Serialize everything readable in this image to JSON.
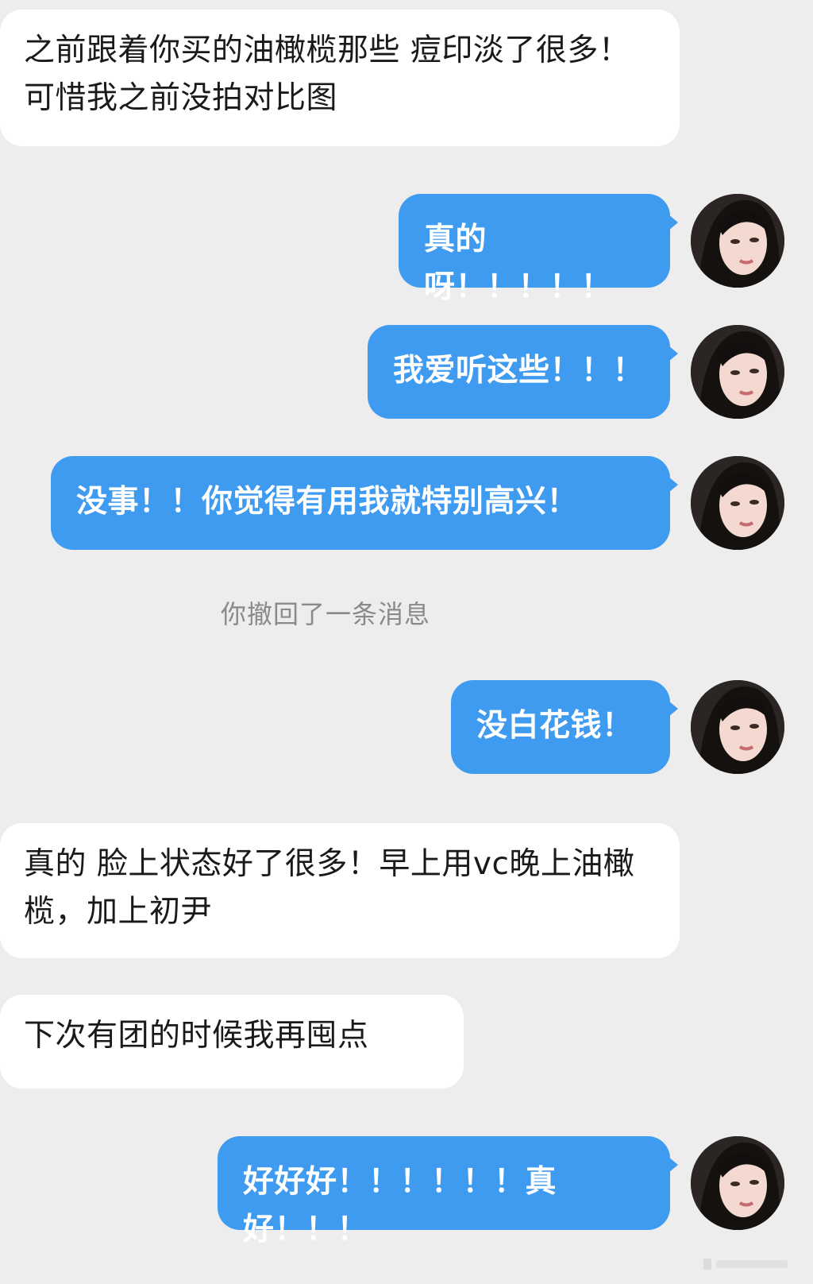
{
  "messages": [
    {
      "side": "in",
      "text": "之前跟着你买的油橄榄那些 痘印淡了很多！可惜我之前没拍对比图"
    },
    {
      "side": "out",
      "text": "真的呀！！！！！"
    },
    {
      "side": "out",
      "text": "我爱听这些！！！"
    },
    {
      "side": "out",
      "text": "没事！！你觉得有用我就特别高兴！"
    },
    {
      "side": "system",
      "text": "你撤回了一条消息"
    },
    {
      "side": "out",
      "text": "没白花钱！"
    },
    {
      "side": "in",
      "text": "真的 脸上状态好了很多！早上用vc晚上油橄榄，加上初尹"
    },
    {
      "side": "in",
      "text": "下次有团的时候我再囤点"
    },
    {
      "side": "out",
      "text": "好好好！！！！！！真好！！！"
    }
  ],
  "colors": {
    "background": "#ededed",
    "incoming_bubble": "#ffffff",
    "outgoing_bubble": "#3f9bf0",
    "system_text": "#8a8a8a"
  },
  "icons": {
    "avatar": "user-avatar-photo"
  }
}
